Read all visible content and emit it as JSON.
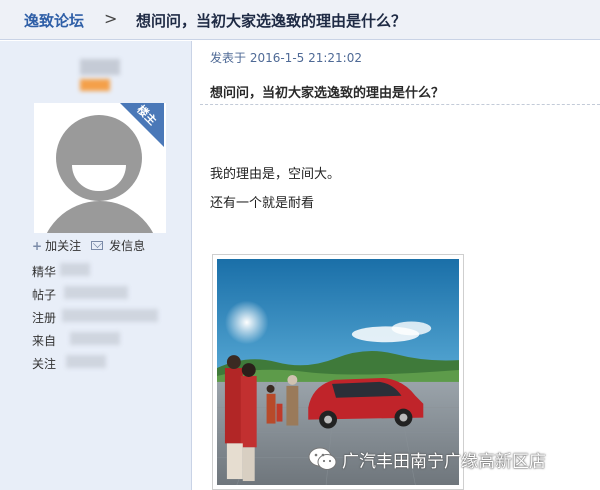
{
  "header": {
    "forum_name": "逸致论坛",
    "separator": ">",
    "thread_title": "想问问，当初大家选逸致的理由是什么？"
  },
  "user_panel": {
    "badge": "楼主",
    "follow_label": "加关注",
    "message_label": "发信息",
    "stats": [
      {
        "label": "精华"
      },
      {
        "label": "帖子"
      },
      {
        "label": "注册"
      },
      {
        "label": "来自"
      },
      {
        "label": "关注"
      }
    ]
  },
  "post": {
    "date": "发表于 2016-1-5 21:21:02",
    "subject": "想问问，当初大家选逸致的理由是什么？",
    "lines": [
      "我的理由是，空间大。",
      "还有一个就是耐看"
    ]
  },
  "watermark": {
    "text": "广汽丰田南宁广缘高新区店",
    "icon": "wechat-icon"
  },
  "colors": {
    "accent": "#2f5fa7",
    "sidebar_bg": "#e8eef8",
    "badge": "#4a78b8",
    "car": "#c0242a"
  }
}
